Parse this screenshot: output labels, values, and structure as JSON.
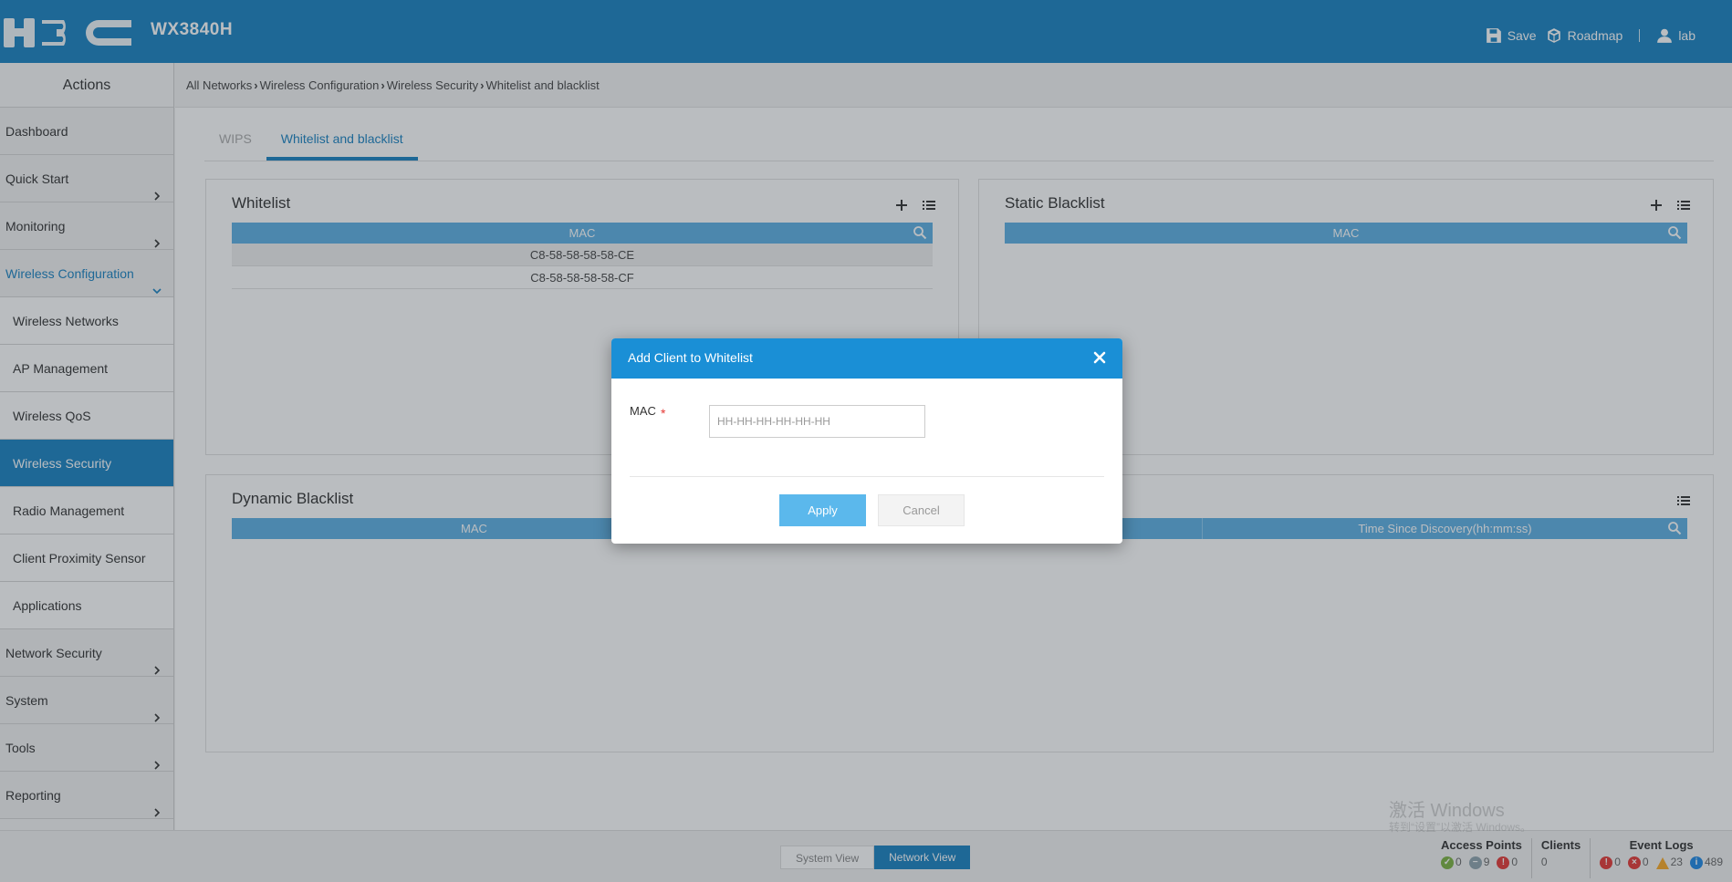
{
  "header": {
    "model": "WX3840H",
    "save_label": "Save",
    "roadmap_label": "Roadmap",
    "user_label": "lab"
  },
  "sidebar": {
    "title": "Actions",
    "items": [
      {
        "label": "Dashboard"
      },
      {
        "label": "Quick Start"
      },
      {
        "label": "Monitoring"
      },
      {
        "label": "Wireless Configuration"
      },
      {
        "label": "Wireless Networks"
      },
      {
        "label": "AP Management"
      },
      {
        "label": "Wireless QoS"
      },
      {
        "label": "Wireless Security"
      },
      {
        "label": "Radio Management"
      },
      {
        "label": "Client Proximity Sensor"
      },
      {
        "label": "Applications"
      },
      {
        "label": "Network Security"
      },
      {
        "label": "System"
      },
      {
        "label": "Tools"
      },
      {
        "label": "Reporting"
      }
    ]
  },
  "breadcrumb": [
    "All Networks",
    "Wireless Configuration",
    "Wireless Security",
    "Whitelist and blacklist"
  ],
  "tabs": [
    {
      "label": "WIPS"
    },
    {
      "label": "Whitelist and blacklist"
    }
  ],
  "whitelist": {
    "title": "Whitelist",
    "column": "MAC",
    "rows": [
      "C8-58-58-58-58-CE",
      "C8-58-58-58-58-CF"
    ]
  },
  "static_blacklist": {
    "title": "Static Blacklist",
    "column": "MAC"
  },
  "dynamic_blacklist": {
    "title": "Dynamic Blacklist",
    "columns": [
      "MAC",
      "",
      "Time Since Discovery(hh:mm:ss)"
    ]
  },
  "footer": {
    "system_view": "System View",
    "network_view": "Network View",
    "access_points": {
      "title": "Access Points",
      "ok": "0",
      "offline": "9",
      "fault": "0"
    },
    "clients": {
      "title": "Clients",
      "count": "0"
    },
    "event_logs": {
      "title": "Event Logs",
      "critical": "0",
      "error": "0",
      "warning": "23",
      "info": "489"
    }
  },
  "watermark": {
    "line1": "激活 Windows",
    "line2": "转到“设置”以激活 Windows。"
  },
  "dialog": {
    "title": "Add Client to Whitelist",
    "field_label": "MAC",
    "required_mark": "*",
    "placeholder": "HH-HH-HH-HH-HH-HH",
    "apply_label": "Apply",
    "cancel_label": "Cancel"
  },
  "colors": {
    "brand": "#1a82c2",
    "table_header": "#5db0e4",
    "dialog_header": "#1a8fd6"
  }
}
